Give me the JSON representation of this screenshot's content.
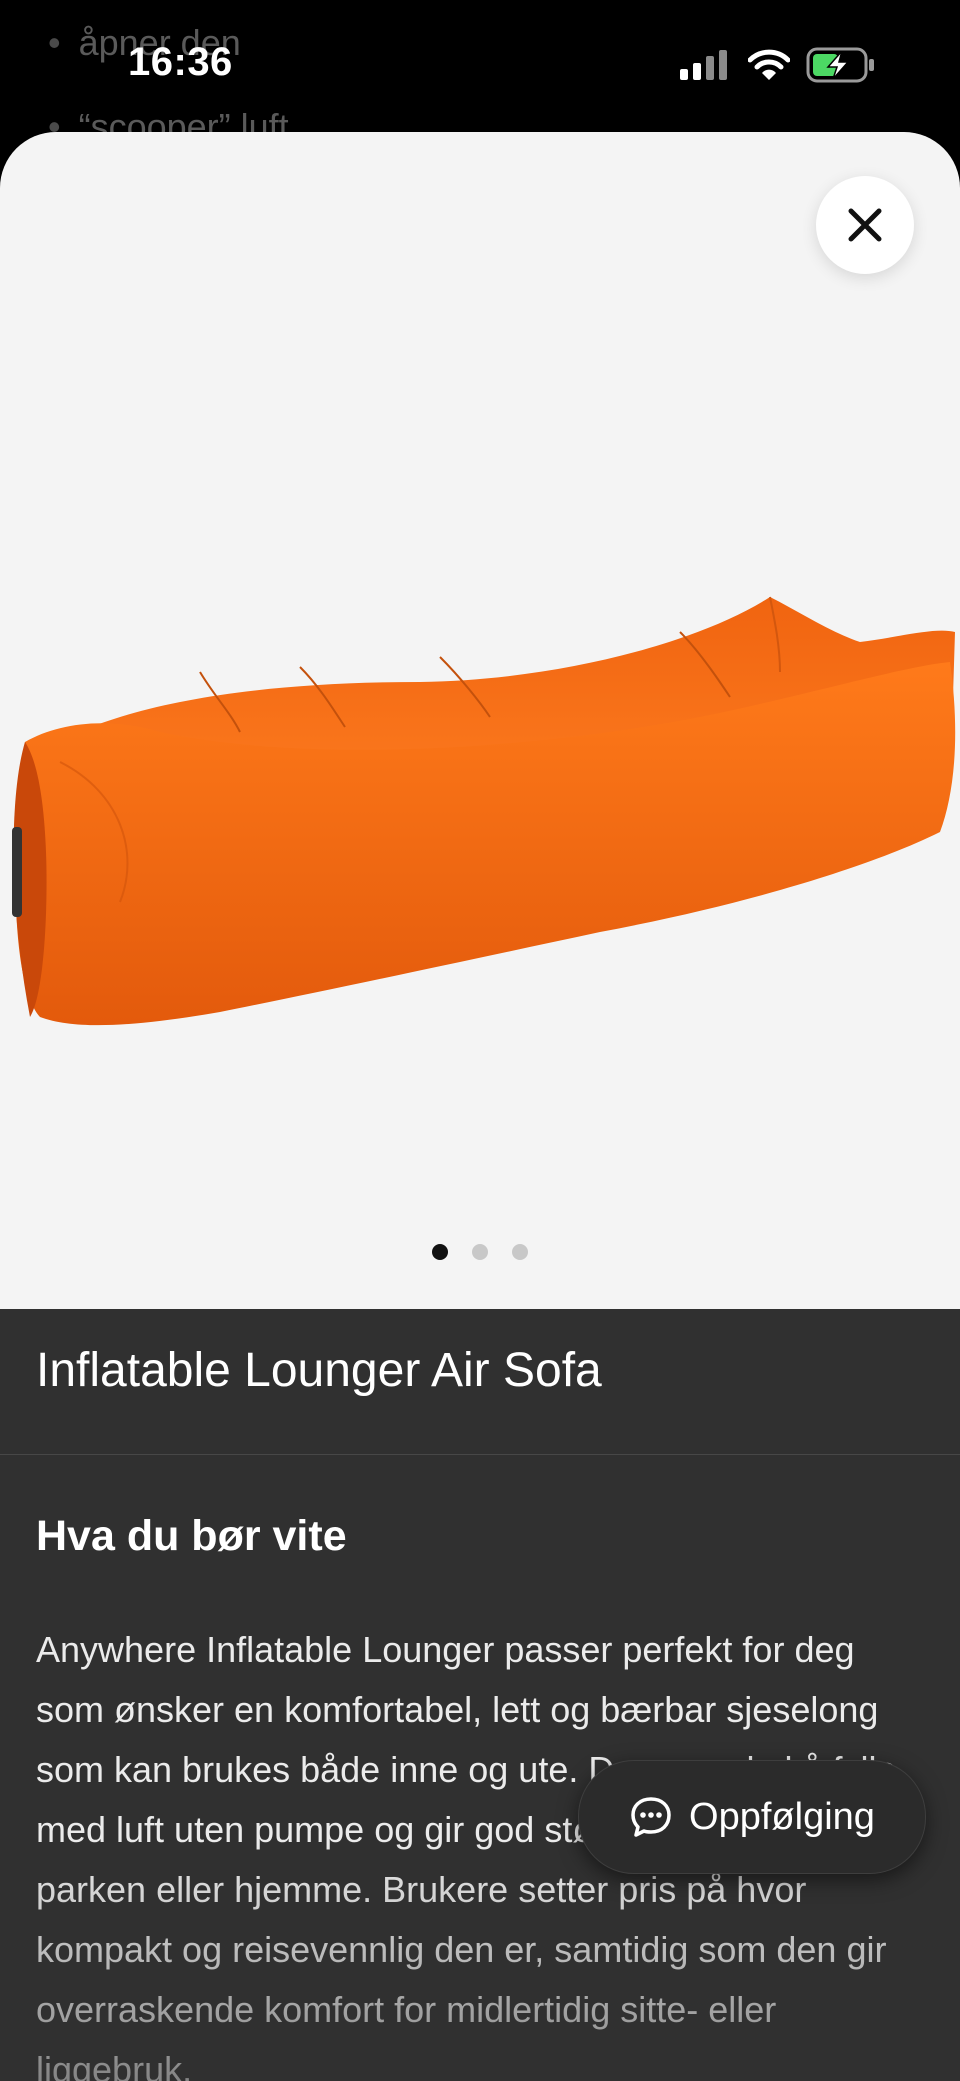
{
  "background": {
    "bullets": [
      "åpner den",
      "“scooper” luft"
    ]
  },
  "status_bar": {
    "time": "16:36",
    "icons": [
      "signal-icon",
      "wifi-icon",
      "battery-charging-icon"
    ]
  },
  "product": {
    "title": "Inflatable Lounger Air Sofa",
    "image_description_icon": "orange-air-sofa-image",
    "carousel": {
      "count": 3,
      "active_index": 1
    },
    "close_icon": "close-icon",
    "accent_color": "#f26a12"
  },
  "info": {
    "heading": "Hva du bør vite",
    "body": "Anywhere Inflatable Lounger passer perfekt for deg som ønsker en komfortabel, lett og bærbar sjeselong som kan brukes både inne og ute. Den er enkel å fylle med luft uten pumpe og gir god støtte på stranden, i parken eller hjemme. Brukere setter pris på hvor kompakt og reisevennlig den er, samtidig som den gir overraskende komfort for midlertidig sitte- eller liggebruk."
  },
  "follow_up": {
    "label": "Oppfølging",
    "icon": "chat-bubble-icon"
  }
}
